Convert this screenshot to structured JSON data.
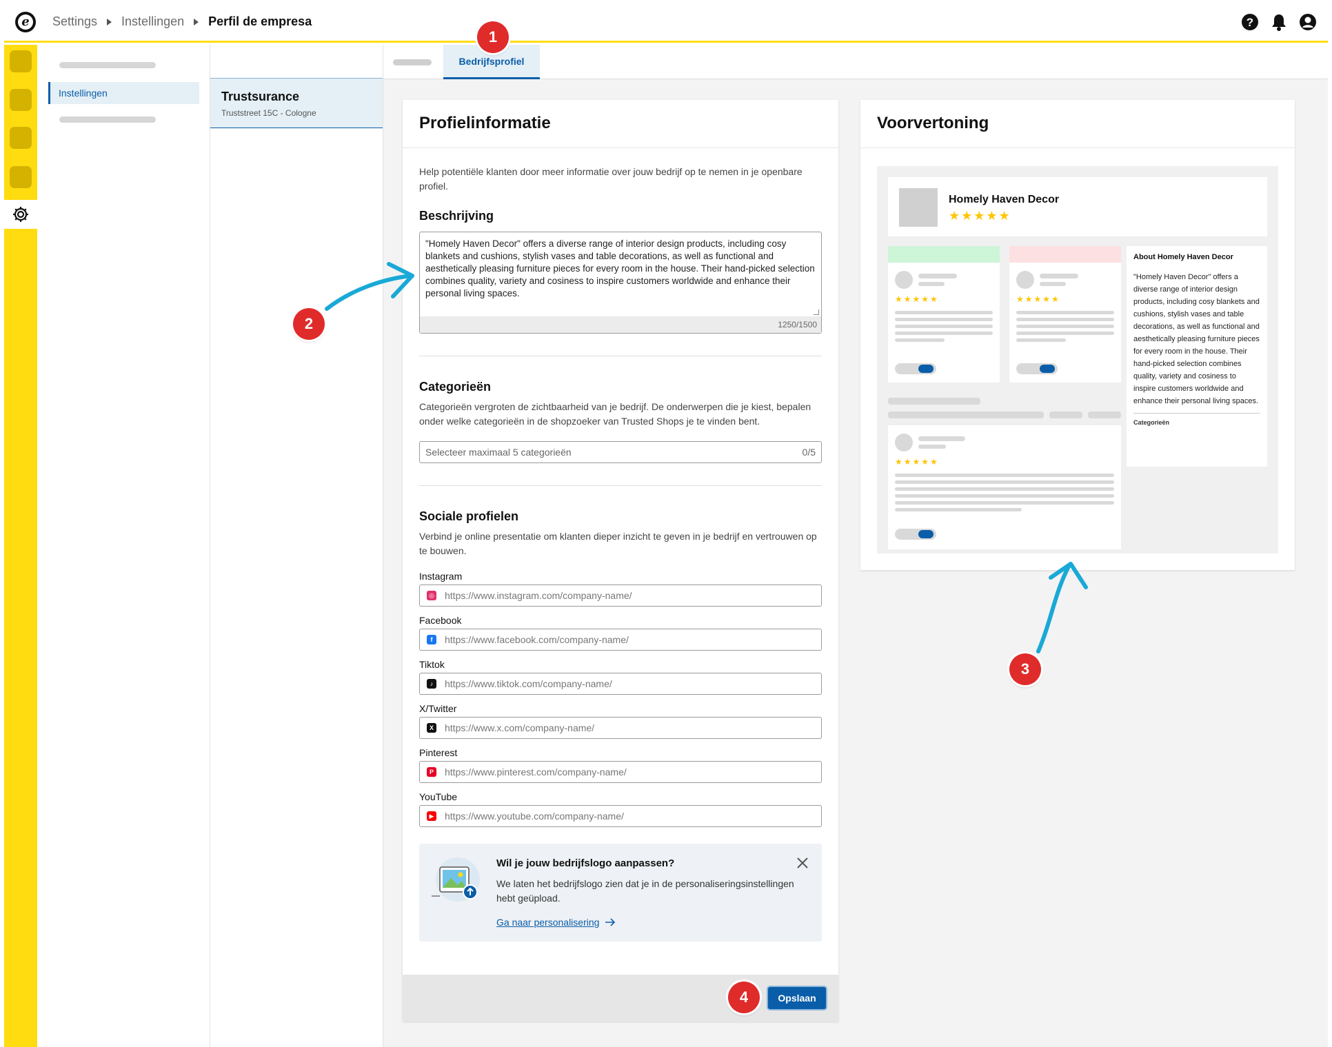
{
  "breadcrumb": {
    "items": [
      "Settings",
      "Instellingen",
      "Perfil de empresa"
    ]
  },
  "nav": {
    "active_label": "Instellingen"
  },
  "shop": {
    "name": "Trustsurance",
    "address": "Truststreet 15C - Cologne"
  },
  "tabs": {
    "active_label": "Bedrijfsprofiel"
  },
  "profile": {
    "title": "Profielinformatie",
    "help": "Help potentiële klanten door meer informatie over jouw bedrijf op te nemen in je openbare profiel.",
    "description": {
      "title": "Beschrijving",
      "value": "\"Homely Haven Decor\" offers a diverse range of interior design products, including cosy blankets and cushions, stylish vases and table decorations, as well as functional and aesthetically pleasing furniture pieces for every room in the house. Their hand-picked selection combines quality, variety and cosiness to inspire customers worldwide and enhance their personal living spaces.",
      "counter": "1250/1500"
    },
    "categories": {
      "title": "Categorieën",
      "desc": "Categorieën vergroten de zichtbaarheid van je bedrijf. De onderwerpen die je kiest, bepalen onder welke categorieën in de shopzoeker van Trusted Shops je te vinden bent.",
      "placeholder": "Selecteer maximaal 5 categorieën",
      "counter": "0/5"
    },
    "social": {
      "title": "Sociale profielen",
      "desc": "Verbind je online presentatie om klanten dieper inzicht te geven in je bedrijf en vertrouwen op te bouwen.",
      "fields": [
        {
          "label": "Instagram",
          "placeholder": "https://www.instagram.com/company-name/",
          "icon": "instagram-icon",
          "color": "#e1306c"
        },
        {
          "label": "Facebook",
          "placeholder": "https://www.facebook.com/company-name/",
          "icon": "facebook-icon",
          "color": "#1877f2"
        },
        {
          "label": "Tiktok",
          "placeholder": "https://www.tiktok.com/company-name/",
          "icon": "tiktok-icon",
          "color": "#111111"
        },
        {
          "label": "X/Twitter",
          "placeholder": "https://www.x.com/company-name/",
          "icon": "x-icon",
          "color": "#111111"
        },
        {
          "label": "Pinterest",
          "placeholder": "https://www.pinterest.com/company-name/",
          "icon": "pinterest-icon",
          "color": "#e60023"
        },
        {
          "label": "YouTube",
          "placeholder": "https://www.youtube.com/company-name/",
          "icon": "youtube-icon",
          "color": "#ff0000"
        }
      ]
    },
    "logo_banner": {
      "title": "Wil je jouw bedrijfslogo aanpassen?",
      "text": "We laten het bedrijfslogo zien dat je in de personaliseringsinstellingen hebt geüpload.",
      "link": "Ga naar personalisering"
    },
    "save_label": "Opslaan"
  },
  "preview": {
    "title": "Voorvertoning",
    "shop_name": "Homely Haven Decor",
    "stars": "★★★★★",
    "review_stars": "★★★★★",
    "about_title": "About Homely Haven Decor",
    "about_text": "\"Homely Haven Decor\" offers a diverse range of interior design products, including cosy blankets and cushions, stylish vases and table decorations, as well as functional and aesthetically pleasing furniture pieces for every room in the house. Their hand-picked selection combines quality, variety and cosiness to inspire customers worldwide and enhance their personal living spaces.",
    "about_categories": "Categorieën"
  },
  "annotations": [
    "1",
    "2",
    "3",
    "4"
  ],
  "colors": {
    "brand_yellow": "#ffdc0f",
    "accent_blue": "#0a5da8",
    "badge_red": "#e02b2b",
    "arrow_blue": "#1aa9d6",
    "star_yellow": "#ffc400"
  }
}
